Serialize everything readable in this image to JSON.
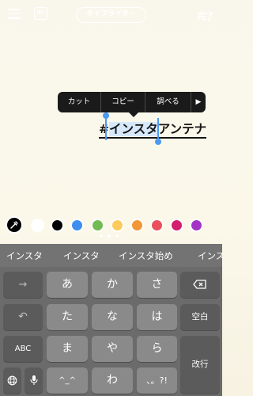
{
  "topbar": {
    "menu_icon": "hamburger-icon",
    "style_icon": "text-style-icon",
    "style_label": "A*",
    "font_label": "タイプライター",
    "done_label": "完了"
  },
  "context_menu": {
    "items": [
      "カット",
      "コピー",
      "調べる"
    ],
    "more_icon": "triangle-right-icon"
  },
  "text": {
    "before": "#",
    "selected": "インスタ",
    "after": "アンテナ"
  },
  "palette": {
    "eyedropper_icon": "eyedropper-icon",
    "colors": [
      "#ffffff",
      "#000000",
      "#3d8ef0",
      "#72bb53",
      "#fdcb5c",
      "#f19737",
      "#e9505b",
      "#d11f6d",
      "#a233c6"
    ],
    "page_dots": 3,
    "active_dot": 1
  },
  "keyboard": {
    "candidates": [
      "インスタ",
      "インスタ",
      "インスタ始め",
      "インス"
    ],
    "keys": {
      "arrow_right": "→",
      "a": "あ",
      "ka": "か",
      "sa": "さ",
      "undo": "↶",
      "ta": "た",
      "na": "な",
      "ha": "は",
      "abc": "ABC",
      "ma": "ま",
      "ya": "や",
      "ra": "ら",
      "emoji": "^_^",
      "wa": "わ",
      "punct": "、。?!",
      "delete_icon": "delete-icon",
      "space": "空白",
      "return": "改行",
      "globe_icon": "globe-icon",
      "mic_icon": "mic-icon"
    }
  }
}
